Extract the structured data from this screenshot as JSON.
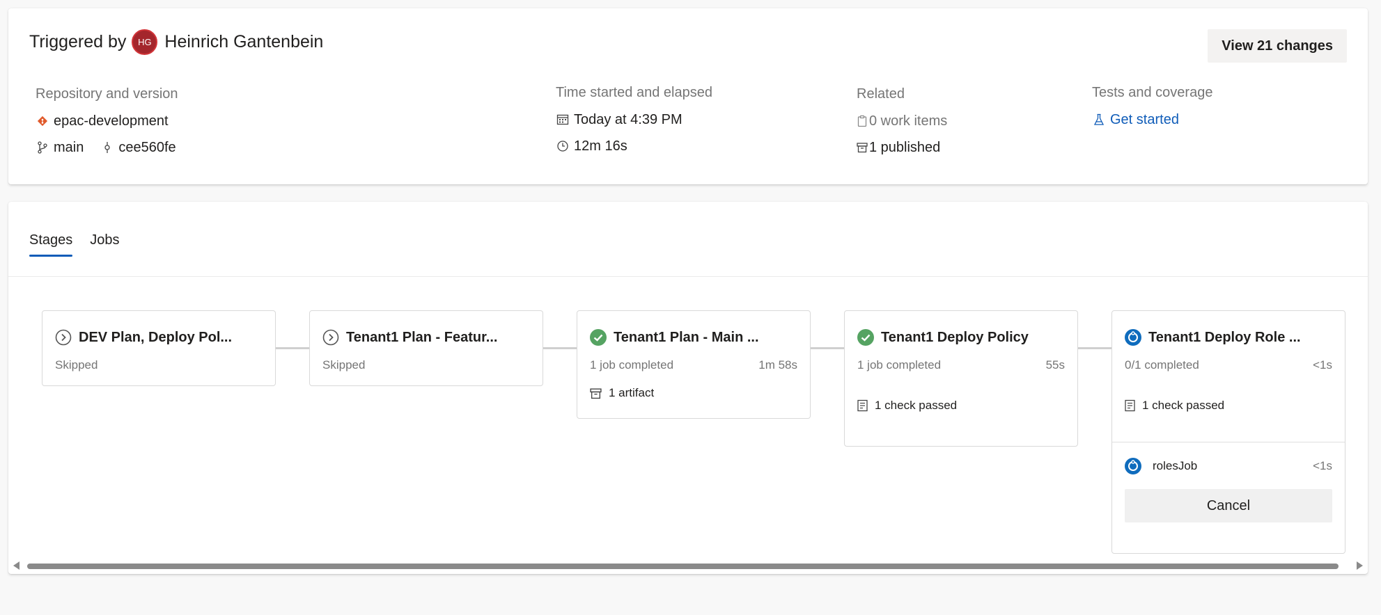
{
  "header": {
    "triggered_prefix": "Triggered by",
    "avatar_initials": "HG",
    "user_name": "Heinrich Gantenbein",
    "view_changes_label": "View 21 changes"
  },
  "repository": {
    "label": "Repository and version",
    "repo_name": "epac-development",
    "branch": "main",
    "commit": "cee560fe"
  },
  "time": {
    "label": "Time started and elapsed",
    "started": "Today at 4:39 PM",
    "elapsed": "12m 16s"
  },
  "related": {
    "label": "Related",
    "work_items": "0 work items",
    "published": "1 published"
  },
  "tests": {
    "label": "Tests and coverage",
    "link": "Get started"
  },
  "tabs": [
    {
      "label": "Stages",
      "active": true
    },
    {
      "label": "Jobs",
      "active": false
    }
  ],
  "stages": [
    {
      "title": "DEV Plan, Deploy Pol...",
      "status": "Skipped",
      "time": "",
      "state": "skipped"
    },
    {
      "title": "Tenant1 Plan - Featur...",
      "status": "Skipped",
      "time": "",
      "state": "skipped"
    },
    {
      "title": "Tenant1 Plan - Main ...",
      "status": "1 job completed",
      "time": "1m 58s",
      "state": "succeeded",
      "extra": "1 artifact"
    },
    {
      "title": "Tenant1 Deploy Policy",
      "status": "1 job completed",
      "time": "55s",
      "state": "succeeded",
      "extra": "1 check passed"
    },
    {
      "title": "Tenant1 Deploy Role ...",
      "status": "0/1 completed",
      "time": "<1s",
      "state": "running",
      "extra": "1 check passed",
      "job": {
        "name": "rolesJob",
        "time": "<1s"
      },
      "cancel_label": "Cancel"
    }
  ],
  "colors": {
    "accent": "#0f5cb8",
    "success": "#55a362",
    "running": "#0f6cbd",
    "avatar": "#a4262c",
    "git": "#e05a2b"
  }
}
